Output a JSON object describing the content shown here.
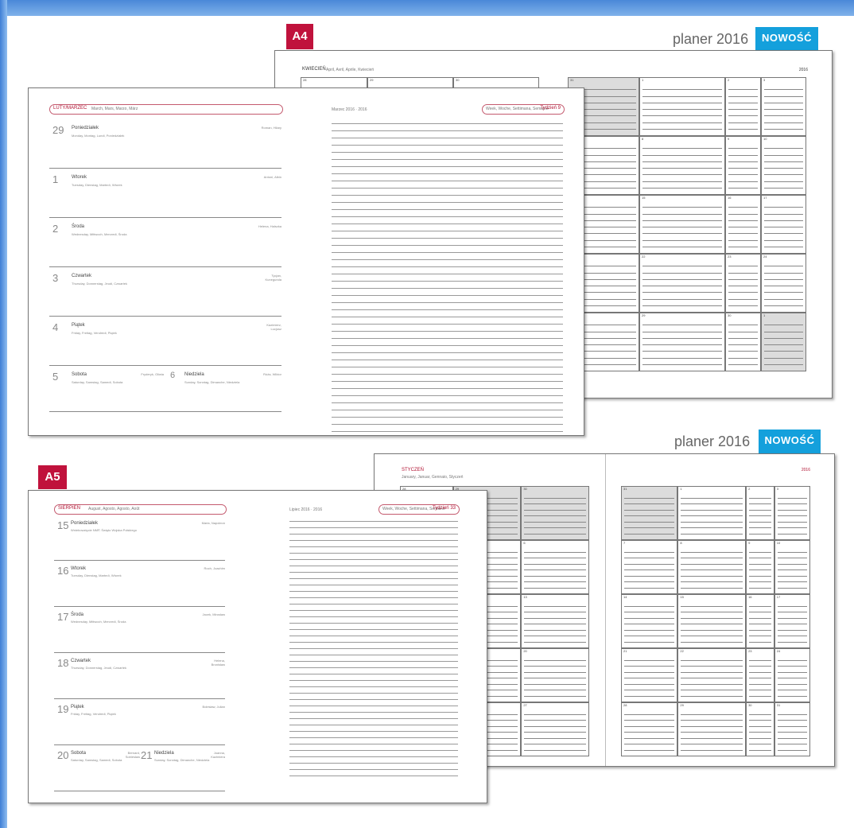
{
  "a4": {
    "badge": "A4",
    "title": "planer 2016",
    "new_label": "NOWOŚĆ",
    "month_back": "KWIECIEŃ",
    "month_back_sub": "April, Avril, Aprile, Kwiecień",
    "year_back": "2016",
    "week_header": "LUTY/MARZEC",
    "week_header_sub": "March, Mars, Marzo, März",
    "week_right_date": "Marzec 2016 · 2016",
    "week_right_hint": "Week, Woche, Settimana, Semaine",
    "week_label": "Tydzień 9",
    "grid_numbers": [
      "28",
      "29",
      "30",
      "31",
      "1",
      "2",
      "3",
      "4",
      "5",
      "6",
      "7",
      "8",
      "9",
      "10",
      "11",
      "12",
      "13",
      "14",
      "15",
      "16",
      "17",
      "18",
      "19",
      "20",
      "21",
      "22",
      "23",
      "24",
      "25",
      "26",
      "27",
      "28",
      "29",
      "30",
      "1",
      "2"
    ],
    "days": [
      {
        "num": "29",
        "name": "Poniedziałek",
        "sub": "Monday, Montag, Lundi, Poniedziałek",
        "right": "Roman, Hilary"
      },
      {
        "num": "1",
        "name": "Wtorek",
        "sub": "Tuesday, Dienstag, Martedì, Wtorek",
        "right": "Antoni, Albin"
      },
      {
        "num": "2",
        "name": "Środa",
        "sub": "Wednesday, Mittwoch, Mercredi, Środa",
        "right": "Helena, Halszka"
      },
      {
        "num": "3",
        "name": "Czwartek",
        "sub": "Thursday, Donnerstag, Jeudi, Czwartek",
        "right": "Tycjan, Kunegunda"
      },
      {
        "num": "4",
        "name": "Piątek",
        "sub": "Friday, Freitag, Vendredi, Piątek",
        "right": "Kazimierz, Lucjusz"
      },
      {
        "num": "5",
        "name": "Sobota",
        "sub": "Saturday, Samstag, Samedi, Sobota",
        "right": "Fryderyk, Oliwia"
      },
      {
        "num": "6",
        "name": "Niedziela",
        "sub": "Sunday, Sonntag, Dimanche, Niedziela",
        "right": "Róża, Wiktor"
      }
    ]
  },
  "a5": {
    "badge": "A5",
    "title": "planer 2016",
    "new_label": "NOWOŚĆ",
    "month_back": "STYCZEŃ",
    "month_back_sub": "January, Januar, Gennaio, Styczeń",
    "year_back": "2016",
    "week_header": "SIERPIEŃ",
    "week_header_sub": "August, Agosto, Agosto, Août",
    "week_right_date": "Lipiec 2016 · 2016",
    "week_right_hint": "Week, Woche, Settimana, Semaine",
    "week_label": "Tydzień 33",
    "grid_numbers": [
      "28",
      "29",
      "30",
      "31",
      "1",
      "2",
      "3",
      "4",
      "5",
      "6",
      "7",
      "8",
      "9",
      "10",
      "11",
      "12",
      "13",
      "14",
      "15",
      "16",
      "17",
      "18",
      "19",
      "20",
      "21",
      "22",
      "23",
      "24",
      "25",
      "26",
      "27",
      "28",
      "29",
      "30",
      "31",
      "1"
    ],
    "days": [
      {
        "num": "15",
        "name": "Poniedziałek",
        "sub": "Wniebowzięcie NMP, Święto Wojska Polskiego",
        "right": "Maria, Napoleon"
      },
      {
        "num": "16",
        "name": "Wtorek",
        "sub": "Tuesday, Dienstag, Martedì, Wtorek",
        "right": "Roch, Joachim"
      },
      {
        "num": "17",
        "name": "Środa",
        "sub": "Wednesday, Mittwoch, Mercredi, Środa",
        "right": "Jacek, Mirosław"
      },
      {
        "num": "18",
        "name": "Czwartek",
        "sub": "Thursday, Donnerstag, Jeudi, Czwartek",
        "right": "Helena, Bronisław"
      },
      {
        "num": "19",
        "name": "Piątek",
        "sub": "Friday, Freitag, Vendredi, Piątek",
        "right": "Bolesław, Julian"
      },
      {
        "num": "20",
        "name": "Sobota",
        "sub": "Saturday, Samstag, Samedi, Sobota",
        "right": "Bernard, Sobiesław"
      },
      {
        "num": "21",
        "name": "Niedziela",
        "sub": "Sunday, Sonntag, Dimanche, Niedziela",
        "right": "Joanna, Kazimiera"
      }
    ]
  }
}
